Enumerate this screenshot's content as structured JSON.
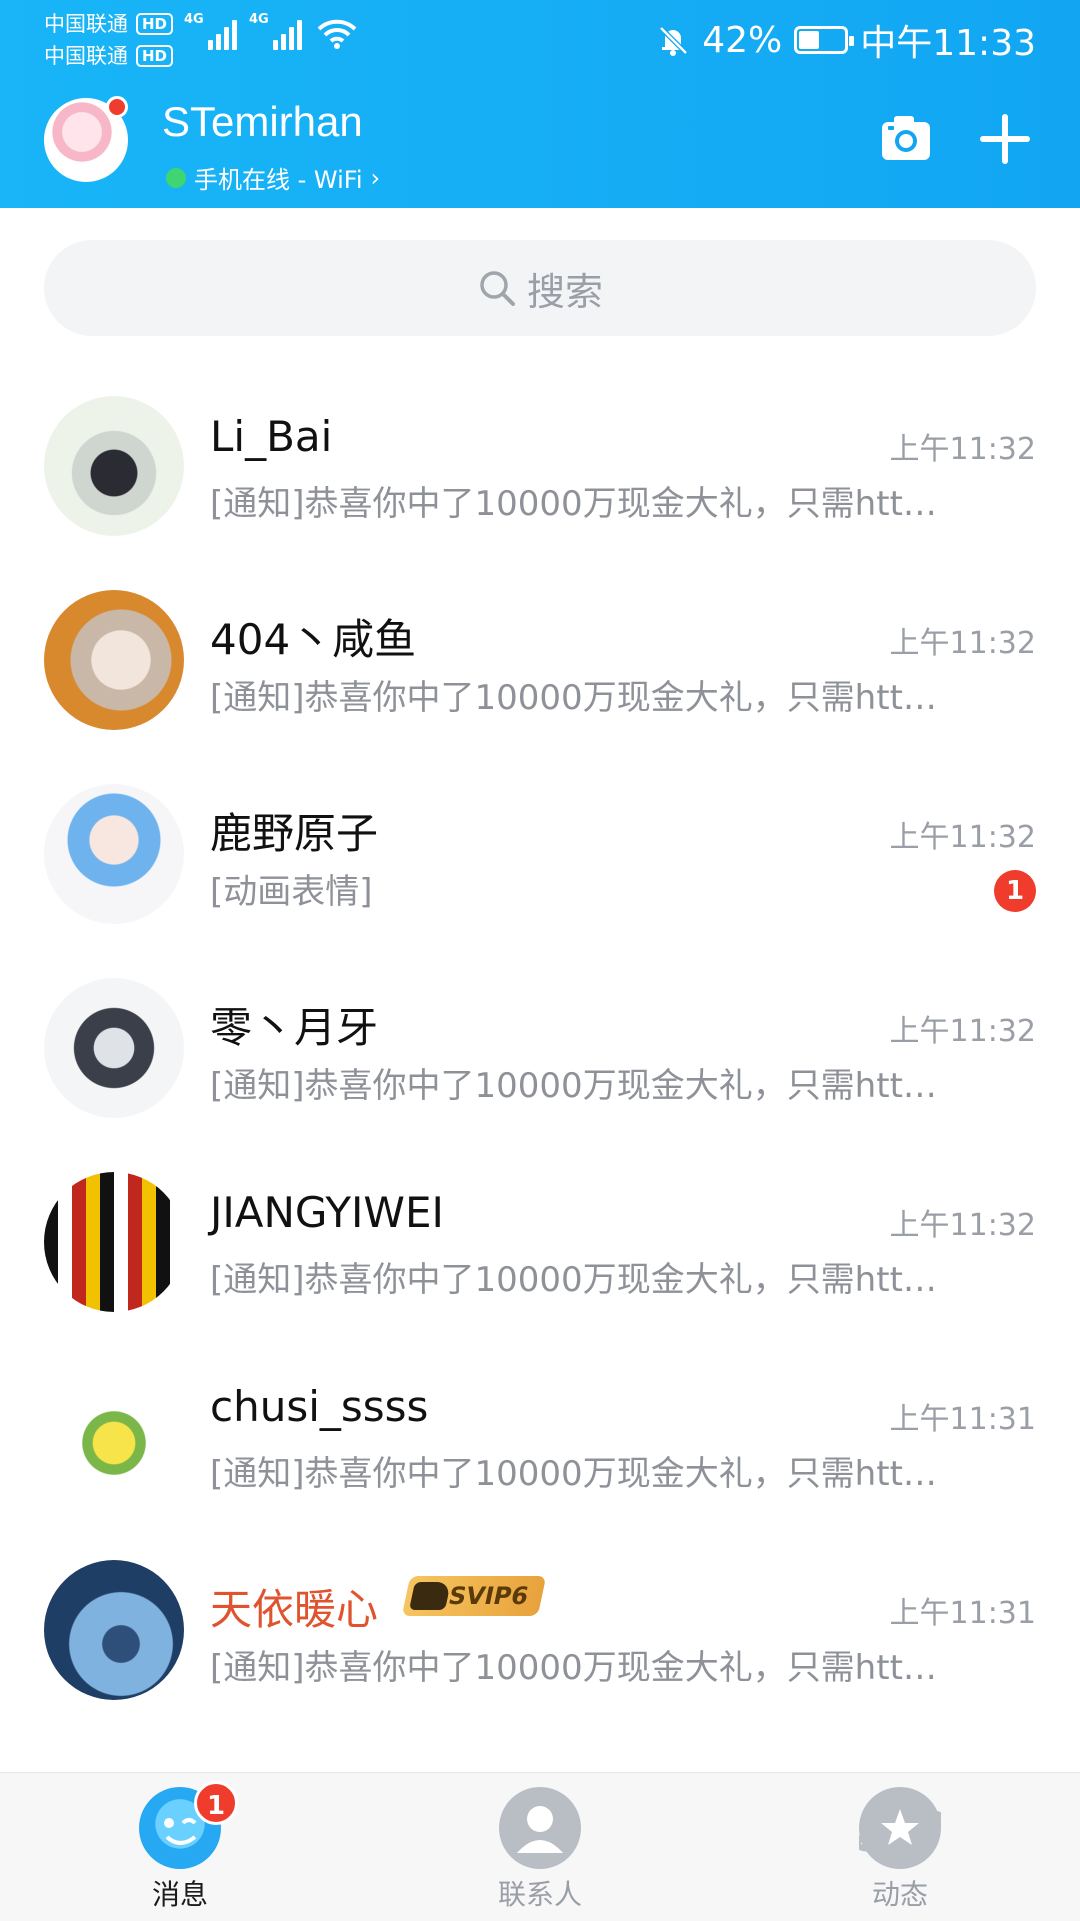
{
  "status_bar": {
    "carrier1": "中国联通",
    "carrier2": "中国联通",
    "hd_label": "HD",
    "net_label": "4G",
    "battery": "42%",
    "battery_level": 0.42,
    "time": "中午11:33"
  },
  "header": {
    "username": "STemirhan",
    "online_status": "手机在线 - WiFi",
    "accent_color": "#12a6f2"
  },
  "search": {
    "placeholder": "搜索"
  },
  "conversations": [
    {
      "name": "Li_Bai",
      "time": "上午11:32",
      "preview": "[通知]恭喜你中了10000万现金大礼，只需htt…"
    },
    {
      "name": "404丶咸鱼",
      "time": "上午11:32",
      "preview": "[通知]恭喜你中了10000万现金大礼，只需htt…"
    },
    {
      "name": "鹿野原子",
      "time": "上午11:32",
      "preview": "[动画表情]",
      "badge": "1"
    },
    {
      "name": "零丶月牙",
      "time": "上午11:32",
      "preview": "[通知]恭喜你中了10000万现金大礼，只需htt…"
    },
    {
      "name": "JIANGYIWEI",
      "time": "上午11:32",
      "preview": "[通知]恭喜你中了10000万现金大礼，只需htt…"
    },
    {
      "name": "chusi_ssss",
      "time": "上午11:31",
      "preview": "[通知]恭喜你中了10000万现金大礼，只需htt…"
    },
    {
      "name": "天依暖心",
      "time": "上午11:31",
      "preview": "[通知]恭喜你中了10000万现金大礼，只需htt…",
      "vip_label": "SVIP6"
    }
  ],
  "nav": {
    "messages": "消息",
    "messages_badge": "1",
    "contacts": "联系人",
    "moments": "动态"
  }
}
